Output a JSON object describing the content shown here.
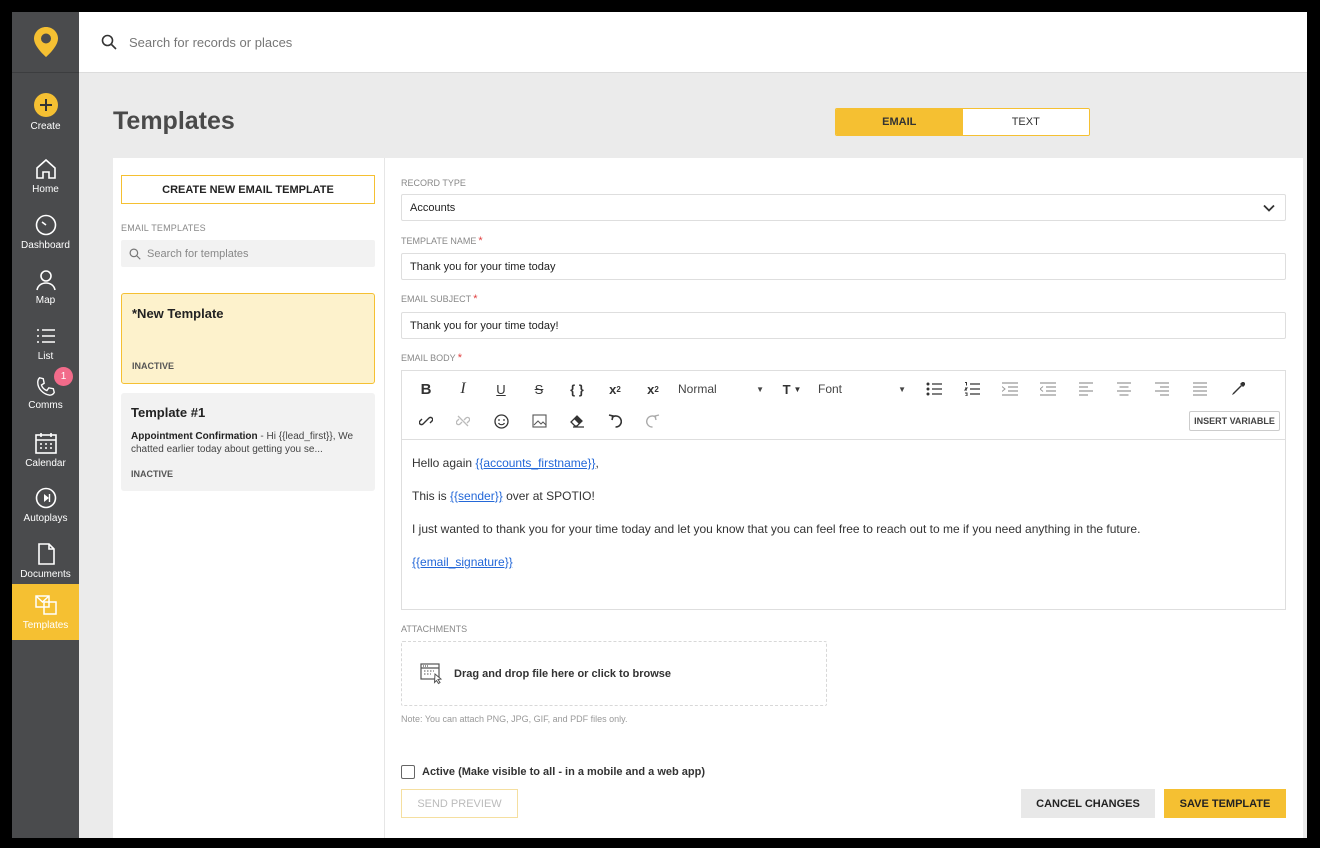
{
  "topbar": {
    "search_placeholder": "Search for records or places"
  },
  "nav": {
    "create": "Create",
    "home": "Home",
    "dashboard": "Dashboard",
    "map": "Map",
    "list": "List",
    "comms": "Comms",
    "comms_badge": "1",
    "calendar": "Calendar",
    "autoplays": "Autoplays",
    "documents": "Documents",
    "templates": "Templates"
  },
  "page": {
    "title": "Templates",
    "tabs": [
      "EMAIL",
      "TEXT"
    ],
    "active_tab": "EMAIL"
  },
  "left": {
    "create_button": "CREATE NEW EMAIL TEMPLATE",
    "section_label": "EMAIL TEMPLATES",
    "search_placeholder": "Search for templates",
    "templates": [
      {
        "title": "*New Template",
        "status": "INACTIVE"
      },
      {
        "title": "Template #1",
        "desc_bold": "Appointment Confirmation",
        "desc": " - Hi {{lead_first}}, We chatted earlier today about getting you se...",
        "status": "INACTIVE"
      }
    ]
  },
  "form": {
    "record_type_label": "RECORD TYPE",
    "record_type_value": "Accounts",
    "template_name_label": "TEMPLATE NAME",
    "template_name_value": "Thank you for your time today",
    "email_subject_label": "EMAIL SUBJECT",
    "email_subject_value": "Thank you for your time today!",
    "email_body_label": "EMAIL BODY",
    "toolbar": {
      "size_select": "Normal",
      "font_select": "Font",
      "insert_variable": "INSERT VARIABLE"
    },
    "body": {
      "line1_prefix": "Hello again ",
      "line1_var": "{{accounts_firstname}}",
      "line1_suffix": ",",
      "line2_prefix": "This is ",
      "line2_var": "{{sender}}",
      "line2_suffix": " over at SPOTIO!",
      "line3": "I just wanted to thank you for your time today and let you know that you can feel free to reach out to me if you need anything in the future.",
      "line4_var": "{{email_signature}}"
    },
    "attachments_label": "ATTACHMENTS",
    "dropzone_text": "Drag and drop file here or click to browse",
    "attach_note": "Note: You can attach PNG, JPG, GIF, and PDF files only.",
    "active_label": "Active (Make visible to all - in a mobile and a web app)",
    "send_preview": "SEND PREVIEW",
    "cancel": "CANCEL CHANGES",
    "save": "SAVE TEMPLATE"
  },
  "colors": {
    "accent": "#f5c032",
    "sidebar": "#4a4b4d",
    "link": "#2468d8"
  }
}
